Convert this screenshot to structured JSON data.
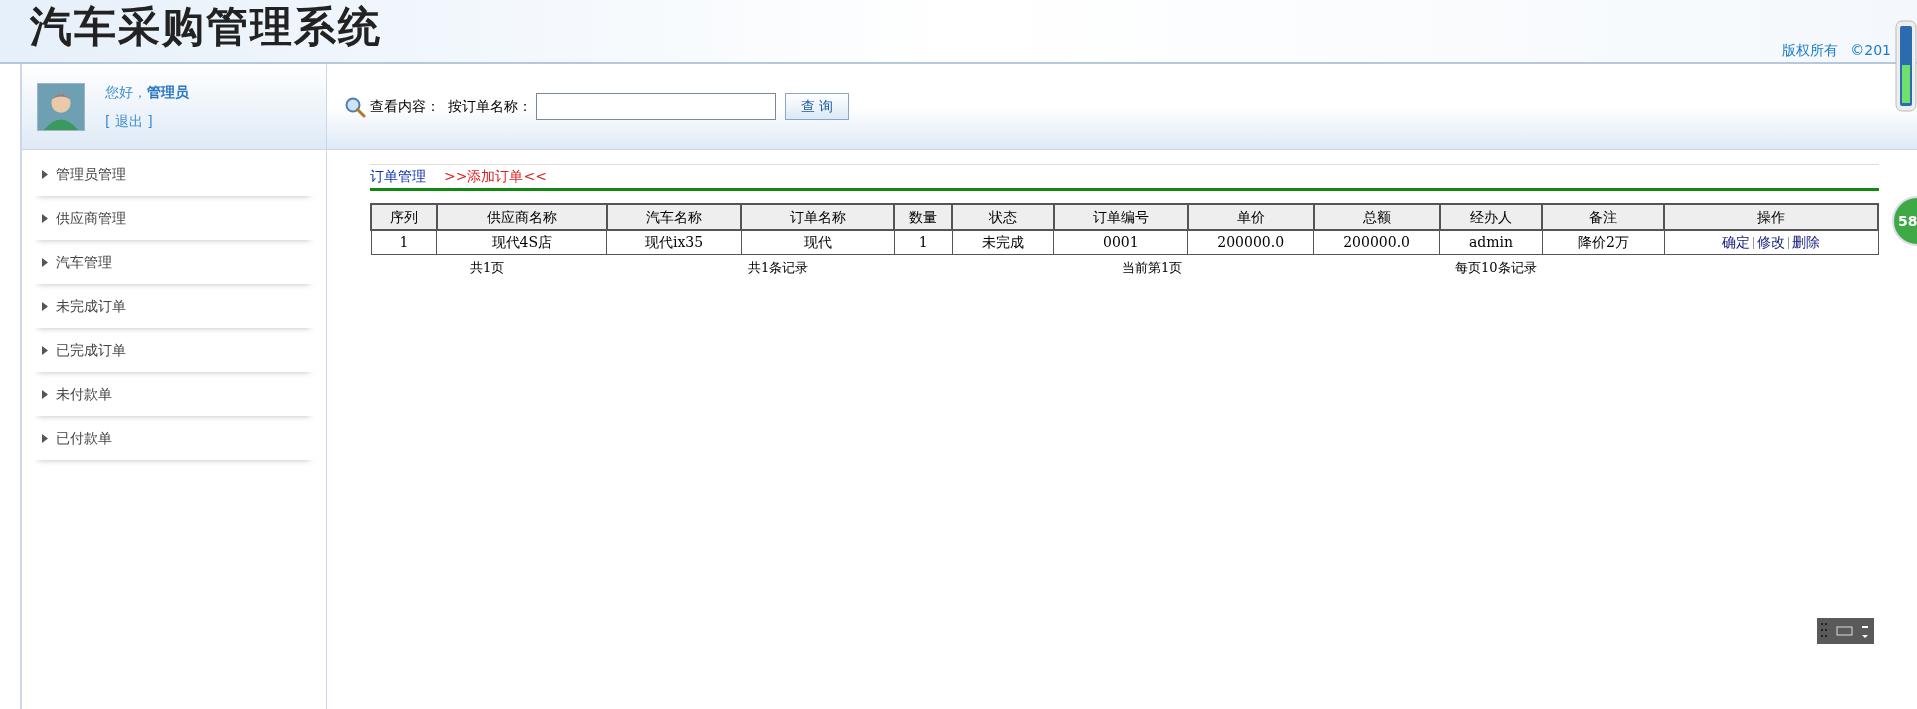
{
  "header": {
    "title": "汽车采购管理系统",
    "copyright": "版权所有",
    "year": "©201"
  },
  "user": {
    "greeting": "您好，",
    "name": "管理员",
    "logout": "[ 退出 ]"
  },
  "sidebar": {
    "items": [
      {
        "label": "管理员管理"
      },
      {
        "label": "供应商管理"
      },
      {
        "label": "汽车管理"
      },
      {
        "label": "未完成订单"
      },
      {
        "label": "已完成订单"
      },
      {
        "label": "未付款单"
      },
      {
        "label": "已付款单"
      }
    ]
  },
  "search": {
    "title": "查看内容：",
    "label": "按订单名称：",
    "button": "查 询"
  },
  "tabs": [
    {
      "label": "订单管理",
      "selected": true
    },
    {
      "label": ">>添加订单<<",
      "selected": false
    }
  ],
  "table": {
    "columns": [
      "序列",
      "供应商名称",
      "汽车名称",
      "订单名称",
      "数量",
      "状态",
      "订单编号",
      "单价",
      "总额",
      "经办人",
      "备注",
      "操作"
    ],
    "rows": [
      {
        "cells": [
          "1",
          "现代4S店",
          "现代ix35",
          "现代",
          "1",
          "未完成",
          "0001",
          "200000.0",
          "200000.0",
          "admin",
          "降价2万"
        ],
        "actions": [
          "确定",
          "修改",
          "删除"
        ]
      }
    ]
  },
  "pager": [
    "共1页",
    "共1条记录",
    "当前第1页",
    "每页10条记录"
  ],
  "badge": "58"
}
